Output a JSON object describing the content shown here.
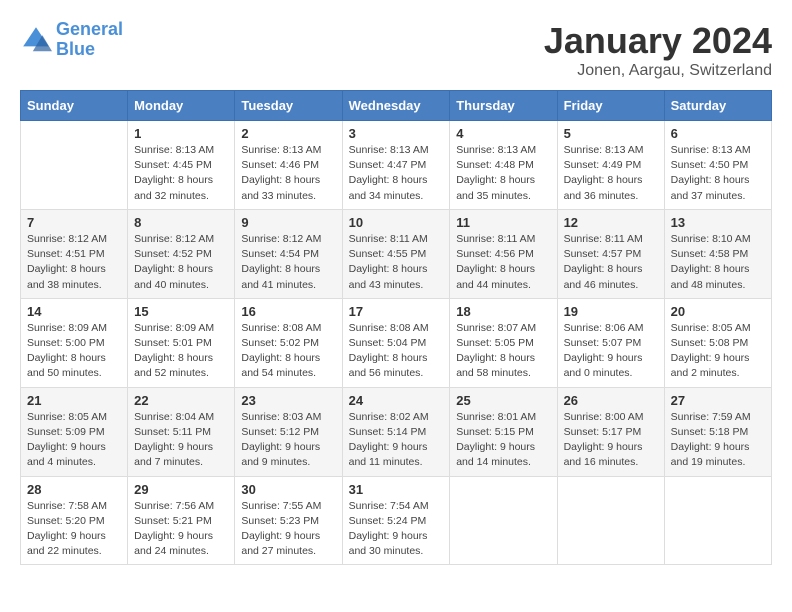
{
  "logo": {
    "line1": "General",
    "line2": "Blue"
  },
  "title": "January 2024",
  "subtitle": "Jonen, Aargau, Switzerland",
  "days_of_week": [
    "Sunday",
    "Monday",
    "Tuesday",
    "Wednesday",
    "Thursday",
    "Friday",
    "Saturday"
  ],
  "weeks": [
    [
      {
        "day": "",
        "sunrise": "",
        "sunset": "",
        "daylight": ""
      },
      {
        "day": "1",
        "sunrise": "Sunrise: 8:13 AM",
        "sunset": "Sunset: 4:45 PM",
        "daylight": "Daylight: 8 hours and 32 minutes."
      },
      {
        "day": "2",
        "sunrise": "Sunrise: 8:13 AM",
        "sunset": "Sunset: 4:46 PM",
        "daylight": "Daylight: 8 hours and 33 minutes."
      },
      {
        "day": "3",
        "sunrise": "Sunrise: 8:13 AM",
        "sunset": "Sunset: 4:47 PM",
        "daylight": "Daylight: 8 hours and 34 minutes."
      },
      {
        "day": "4",
        "sunrise": "Sunrise: 8:13 AM",
        "sunset": "Sunset: 4:48 PM",
        "daylight": "Daylight: 8 hours and 35 minutes."
      },
      {
        "day": "5",
        "sunrise": "Sunrise: 8:13 AM",
        "sunset": "Sunset: 4:49 PM",
        "daylight": "Daylight: 8 hours and 36 minutes."
      },
      {
        "day": "6",
        "sunrise": "Sunrise: 8:13 AM",
        "sunset": "Sunset: 4:50 PM",
        "daylight": "Daylight: 8 hours and 37 minutes."
      }
    ],
    [
      {
        "day": "7",
        "sunrise": "Sunrise: 8:12 AM",
        "sunset": "Sunset: 4:51 PM",
        "daylight": "Daylight: 8 hours and 38 minutes."
      },
      {
        "day": "8",
        "sunrise": "Sunrise: 8:12 AM",
        "sunset": "Sunset: 4:52 PM",
        "daylight": "Daylight: 8 hours and 40 minutes."
      },
      {
        "day": "9",
        "sunrise": "Sunrise: 8:12 AM",
        "sunset": "Sunset: 4:54 PM",
        "daylight": "Daylight: 8 hours and 41 minutes."
      },
      {
        "day": "10",
        "sunrise": "Sunrise: 8:11 AM",
        "sunset": "Sunset: 4:55 PM",
        "daylight": "Daylight: 8 hours and 43 minutes."
      },
      {
        "day": "11",
        "sunrise": "Sunrise: 8:11 AM",
        "sunset": "Sunset: 4:56 PM",
        "daylight": "Daylight: 8 hours and 44 minutes."
      },
      {
        "day": "12",
        "sunrise": "Sunrise: 8:11 AM",
        "sunset": "Sunset: 4:57 PM",
        "daylight": "Daylight: 8 hours and 46 minutes."
      },
      {
        "day": "13",
        "sunrise": "Sunrise: 8:10 AM",
        "sunset": "Sunset: 4:58 PM",
        "daylight": "Daylight: 8 hours and 48 minutes."
      }
    ],
    [
      {
        "day": "14",
        "sunrise": "Sunrise: 8:09 AM",
        "sunset": "Sunset: 5:00 PM",
        "daylight": "Daylight: 8 hours and 50 minutes."
      },
      {
        "day": "15",
        "sunrise": "Sunrise: 8:09 AM",
        "sunset": "Sunset: 5:01 PM",
        "daylight": "Daylight: 8 hours and 52 minutes."
      },
      {
        "day": "16",
        "sunrise": "Sunrise: 8:08 AM",
        "sunset": "Sunset: 5:02 PM",
        "daylight": "Daylight: 8 hours and 54 minutes."
      },
      {
        "day": "17",
        "sunrise": "Sunrise: 8:08 AM",
        "sunset": "Sunset: 5:04 PM",
        "daylight": "Daylight: 8 hours and 56 minutes."
      },
      {
        "day": "18",
        "sunrise": "Sunrise: 8:07 AM",
        "sunset": "Sunset: 5:05 PM",
        "daylight": "Daylight: 8 hours and 58 minutes."
      },
      {
        "day": "19",
        "sunrise": "Sunrise: 8:06 AM",
        "sunset": "Sunset: 5:07 PM",
        "daylight": "Daylight: 9 hours and 0 minutes."
      },
      {
        "day": "20",
        "sunrise": "Sunrise: 8:05 AM",
        "sunset": "Sunset: 5:08 PM",
        "daylight": "Daylight: 9 hours and 2 minutes."
      }
    ],
    [
      {
        "day": "21",
        "sunrise": "Sunrise: 8:05 AM",
        "sunset": "Sunset: 5:09 PM",
        "daylight": "Daylight: 9 hours and 4 minutes."
      },
      {
        "day": "22",
        "sunrise": "Sunrise: 8:04 AM",
        "sunset": "Sunset: 5:11 PM",
        "daylight": "Daylight: 9 hours and 7 minutes."
      },
      {
        "day": "23",
        "sunrise": "Sunrise: 8:03 AM",
        "sunset": "Sunset: 5:12 PM",
        "daylight": "Daylight: 9 hours and 9 minutes."
      },
      {
        "day": "24",
        "sunrise": "Sunrise: 8:02 AM",
        "sunset": "Sunset: 5:14 PM",
        "daylight": "Daylight: 9 hours and 11 minutes."
      },
      {
        "day": "25",
        "sunrise": "Sunrise: 8:01 AM",
        "sunset": "Sunset: 5:15 PM",
        "daylight": "Daylight: 9 hours and 14 minutes."
      },
      {
        "day": "26",
        "sunrise": "Sunrise: 8:00 AM",
        "sunset": "Sunset: 5:17 PM",
        "daylight": "Daylight: 9 hours and 16 minutes."
      },
      {
        "day": "27",
        "sunrise": "Sunrise: 7:59 AM",
        "sunset": "Sunset: 5:18 PM",
        "daylight": "Daylight: 9 hours and 19 minutes."
      }
    ],
    [
      {
        "day": "28",
        "sunrise": "Sunrise: 7:58 AM",
        "sunset": "Sunset: 5:20 PM",
        "daylight": "Daylight: 9 hours and 22 minutes."
      },
      {
        "day": "29",
        "sunrise": "Sunrise: 7:56 AM",
        "sunset": "Sunset: 5:21 PM",
        "daylight": "Daylight: 9 hours and 24 minutes."
      },
      {
        "day": "30",
        "sunrise": "Sunrise: 7:55 AM",
        "sunset": "Sunset: 5:23 PM",
        "daylight": "Daylight: 9 hours and 27 minutes."
      },
      {
        "day": "31",
        "sunrise": "Sunrise: 7:54 AM",
        "sunset": "Sunset: 5:24 PM",
        "daylight": "Daylight: 9 hours and 30 minutes."
      },
      {
        "day": "",
        "sunrise": "",
        "sunset": "",
        "daylight": ""
      },
      {
        "day": "",
        "sunrise": "",
        "sunset": "",
        "daylight": ""
      },
      {
        "day": "",
        "sunrise": "",
        "sunset": "",
        "daylight": ""
      }
    ]
  ]
}
